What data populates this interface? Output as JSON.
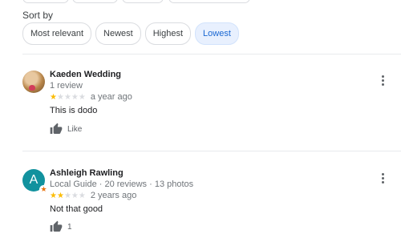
{
  "sort": {
    "label": "Sort by",
    "options": [
      "Most relevant",
      "Newest",
      "Highest",
      "Lowest"
    ],
    "selected": "Lowest"
  },
  "reviews": [
    {
      "name": "Kaeden Wedding",
      "sub": "1 review",
      "rating": 1,
      "time": "a year ago",
      "text": "This is dodo",
      "like_label": "Like"
    },
    {
      "name": "Ashleigh Rawling",
      "avatar_letter": "A",
      "sub": "Local Guide · 20 reviews · 13 photos",
      "rating": 2,
      "time": "2 years ago",
      "text": "Not that good",
      "like_label": "1"
    }
  ],
  "colors": {
    "star": "#fbbc04",
    "selected_chip_bg": "#e8f0fe",
    "selected_chip_text": "#1967d2",
    "avatar_bg": "#12929e"
  },
  "icons": [
    "thumb-up-icon",
    "more-vert-icon",
    "local-guide-icon",
    "star-icon"
  ]
}
